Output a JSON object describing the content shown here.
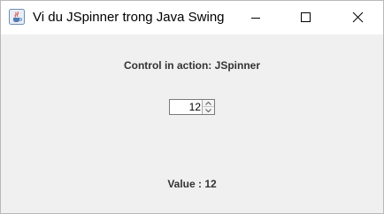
{
  "window": {
    "title": "Vi du JSpinner trong Java Swing",
    "app_icon": "java-cup-icon",
    "controls": {
      "minimize_icon": "minimize-icon",
      "maximize_icon": "maximize-icon",
      "close_icon": "close-icon"
    }
  },
  "main": {
    "heading": "Control in action: JSpinner",
    "spinner": {
      "value": "12",
      "up_icon": "chevron-up-icon",
      "down_icon": "chevron-down-icon"
    },
    "value_label": "Value : 12"
  },
  "colors": {
    "window_background": "#f0f0f0",
    "titlebar_background": "#ffffff",
    "label_text": "#333333"
  }
}
